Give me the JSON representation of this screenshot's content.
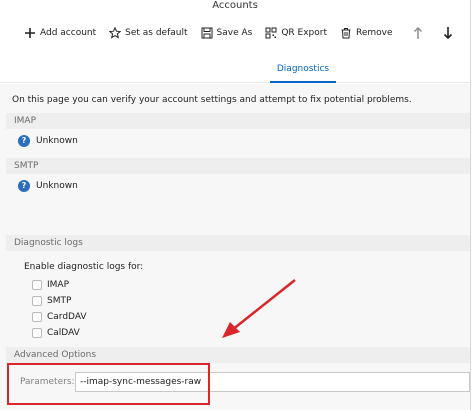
{
  "window": {
    "title": "Accounts"
  },
  "toolbar": {
    "add_account": "Add account",
    "set_default": "Set as default",
    "save_as": "Save As",
    "qr_export": "QR Export",
    "remove": "Remove"
  },
  "tabs": {
    "active": "Diagnostics"
  },
  "intro": "On this page you can verify your account settings and attempt to fix potential problems.",
  "imap": {
    "header": "IMAP",
    "status": "Unknown"
  },
  "smtp": {
    "header": "SMTP",
    "status": "Unknown"
  },
  "diagnostic_logs": {
    "header": "Diagnostic logs",
    "enable_label": "Enable diagnostic logs for:",
    "options": [
      "IMAP",
      "SMTP",
      "CardDAV",
      "CalDAV"
    ]
  },
  "advanced": {
    "header": "Advanced Options",
    "parameters_label": "Parameters:",
    "parameters_value": "--imap-sync-messages-raw"
  },
  "colors": {
    "accent": "#0067c0",
    "highlight": "#d9262b",
    "status_icon": "#2a6ebd"
  }
}
